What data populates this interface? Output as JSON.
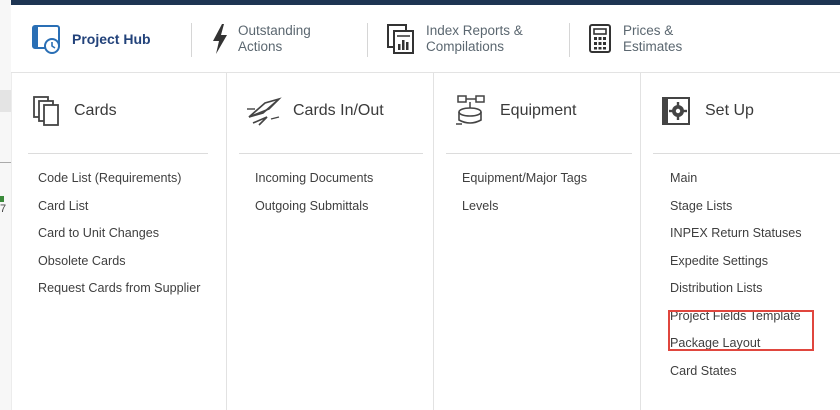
{
  "tabs": [
    {
      "label": "Project Hub",
      "icon": "project-hub-icon",
      "active": true
    },
    {
      "label": "Outstanding\nActions",
      "icon": "lightning-icon",
      "active": false
    },
    {
      "label": "Index Reports &\nCompilations",
      "icon": "reports-icon",
      "active": false
    },
    {
      "label": "Prices &\nEstimates",
      "icon": "calculator-icon",
      "active": false
    }
  ],
  "menu": {
    "columns": [
      {
        "title": "Cards",
        "icon": "cards-icon",
        "items": [
          "Code List (Requirements)",
          "Card List",
          "Card to Unit Changes",
          "Obsolete Cards",
          "Request Cards from Supplier"
        ]
      },
      {
        "title": "Cards In/Out",
        "icon": "cards-in-out-icon",
        "items": [
          "Incoming Documents",
          "Outgoing Submittals"
        ]
      },
      {
        "title": "Equipment",
        "icon": "equipment-icon",
        "items": [
          "Equipment/Major Tags",
          "Levels"
        ]
      },
      {
        "title": "Set Up",
        "icon": "gear-icon",
        "items": [
          "Main",
          "Stage Lists",
          "INPEX Return Statuses",
          "Expedite Settings",
          "Distribution Lists",
          "Project Fields Template",
          "Package Layout",
          "Card States"
        ]
      }
    ]
  },
  "background_page": {
    "visible_text": "7"
  },
  "colors": {
    "brand_navy": "#1e3553",
    "active_tab": "#22427a",
    "highlight": "#e0463e"
  }
}
